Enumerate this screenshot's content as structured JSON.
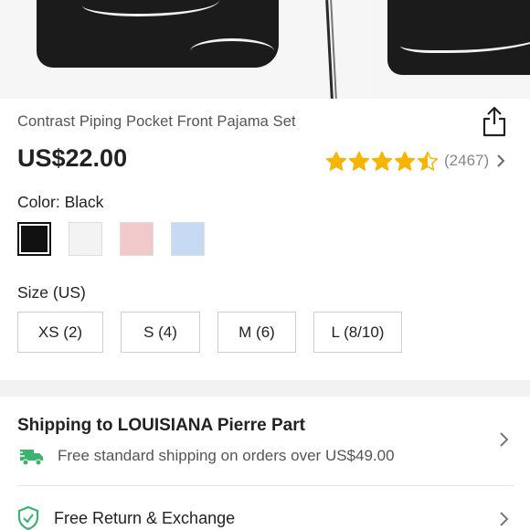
{
  "product": {
    "title": "Contrast Piping Pocket Front Pajama Set",
    "price": "US$22.00",
    "rating": {
      "stars": 4.5,
      "count": "(2467)"
    }
  },
  "color": {
    "label": "Color:",
    "selected": "Black",
    "swatches": [
      {
        "name": "Black",
        "hex": "#111111"
      },
      {
        "name": "White",
        "hex": "#f3f3f3"
      },
      {
        "name": "Pink",
        "hex": "#f1c9cb"
      },
      {
        "name": "Light Blue",
        "hex": "#c6dbf3"
      }
    ]
  },
  "size": {
    "label": "Size (US)",
    "options": [
      "XS (2)",
      "S (4)",
      "M (6)",
      "L (8/10)"
    ]
  },
  "shipping": {
    "title": "Shipping to LOUISIANA Pierre Part",
    "note": "Free standard shipping on orders over US$49.00"
  },
  "returns": {
    "label": "Free Return & Exchange"
  },
  "colors": {
    "accent_green": "#3cb371",
    "star": "#f7b500"
  },
  "icons": [
    "share-icon",
    "star-icon",
    "chevron-right-icon",
    "truck-icon",
    "shield-check-icon"
  ]
}
